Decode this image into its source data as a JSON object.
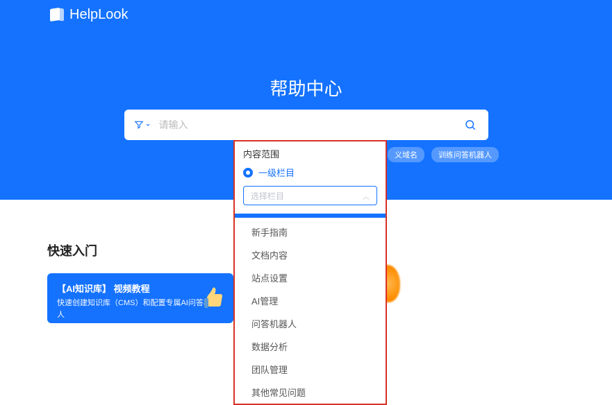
{
  "logo": "HelpLook",
  "hero_title": "帮助中心",
  "search": {
    "placeholder": "请输入"
  },
  "tags": [
    "义域名",
    "训练问答机器人"
  ],
  "panel": {
    "scope_label": "内容范围",
    "radio_label": "一级栏目",
    "select_placeholder": "选择栏目",
    "options": [
      "新手指南",
      "文档内容",
      "站点设置",
      "AI管理",
      "问答机器人",
      "数据分析",
      "团队管理",
      "其他常见问题"
    ]
  },
  "section_title": "快速入门",
  "card": {
    "title": "【AI知识库】 视频教程",
    "desc": "快速创建知识库（CMS）和配置专属AI问答机器人"
  }
}
